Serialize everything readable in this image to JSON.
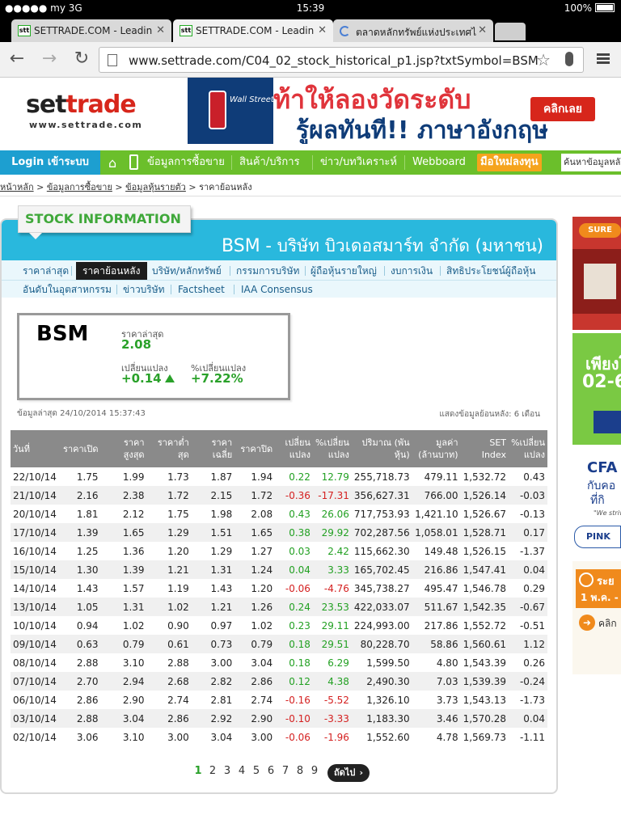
{
  "status_bar": {
    "carrier": "●●●●● my  3G",
    "time": "15:39",
    "battery": "100%"
  },
  "tabs": [
    {
      "title": "SETTRADE.COM - Leadin",
      "favicon": "stt"
    },
    {
      "title": "SETTRADE.COM - Leadin",
      "favicon": "stt"
    },
    {
      "title": "ตลาดหลักทรัพย์แห่งประเทศไ",
      "favicon": "loading"
    }
  ],
  "toolbar": {
    "url": "www.settrade.com/C04_02_stock_historical_p1.jsp?txtSymbol=BSM"
  },
  "header": {
    "logo_main": "set",
    "logo_accent": "trade",
    "logo_sub": "www.settrade.com",
    "banner_brand": "Wall Street English",
    "banner_line1": "ท้าให้ลองวัดระดับ",
    "banner_line2": "รู้ผลทันที!! ภาษาอังกฤษ",
    "banner_button": "คลิกเลย"
  },
  "nav": {
    "login": "Login เข้าระบบ",
    "items": [
      "ข้อมูลการซื้อขาย",
      "สินค้า/บริการ",
      "ข่าว/บทวิเคราะห์",
      "Webboard"
    ],
    "invest": "มือใหม่ลงทุน",
    "search_placeholder": "ค้นหาข้อมูลหลัก"
  },
  "breadcrumb": {
    "home": "หน้าหลัก",
    "trading": "ข้อมูลการซื้อขาย",
    "stock": "ข้อมูลหุ้นรายตัว",
    "current": "ราคาย้อนหลัง"
  },
  "stock_info": {
    "badge": "STOCK INFORMATION",
    "symbol": "BSM",
    "company": "บริษัท บิวเดอสมาร์ท จำกัด (มหาชน)",
    "subnav_row1": [
      "ราคาล่าสุด",
      "ราคาย้อนหลัง",
      "บริษัท/หลักทรัพย์",
      "กรรมการบริษัท",
      "ผู้ถือหุ้นรายใหญ่",
      "งบการเงิน",
      "สิทธิประโยชน์ผู้ถือหุ้น"
    ],
    "subnav_row2": [
      "อันดับในอุตสาหกรรม",
      "ข่าวบริษัท",
      "Factsheet",
      "IAA Consensus"
    ]
  },
  "summary": {
    "symbol": "BSM",
    "last_price_label": "ราคาล่าสุด",
    "last_price": "2.08",
    "change_label": "เปลี่ยนแปลง",
    "change": "+0.14",
    "pct_change_label": "%เปลี่ยนแปลง",
    "pct_change": "+7.22%",
    "last_update": "ข้อมูลล่าสุด 24/10/2014 15:37:43",
    "history_range": "แสดงข้อมูลย้อนหลัง: 6 เดือน"
  },
  "table": {
    "headers": [
      "วันที่",
      "ราคาเปิด",
      "ราคาสูงสุด",
      "ราคาต่ำสุด",
      "ราคาเฉลี่ย",
      "ราคาปิด",
      "เปลี่ยน แปลง",
      "%เปลี่ยน แปลง",
      "ปริมาณ (พันหุ้น)",
      "มูลค่า (ล้านบาท)",
      "SET Index",
      "%เปลี่ยน แปลง"
    ],
    "rows": [
      [
        "22/10/14",
        "1.75",
        "1.99",
        "1.73",
        "1.87",
        "1.94",
        "0.22",
        "12.79",
        "255,718.73",
        "479.11",
        "1,532.72",
        "0.43"
      ],
      [
        "21/10/14",
        "2.16",
        "2.38",
        "1.72",
        "2.15",
        "1.72",
        "-0.36",
        "-17.31",
        "356,627.31",
        "766.00",
        "1,526.14",
        "-0.03"
      ],
      [
        "20/10/14",
        "1.81",
        "2.12",
        "1.75",
        "1.98",
        "2.08",
        "0.43",
        "26.06",
        "717,753.93",
        "1,421.10",
        "1,526.67",
        "-0.13"
      ],
      [
        "17/10/14",
        "1.39",
        "1.65",
        "1.29",
        "1.51",
        "1.65",
        "0.38",
        "29.92",
        "702,287.56",
        "1,058.01",
        "1,528.71",
        "0.17"
      ],
      [
        "16/10/14",
        "1.25",
        "1.36",
        "1.20",
        "1.29",
        "1.27",
        "0.03",
        "2.42",
        "115,662.30",
        "149.48",
        "1,526.15",
        "-1.37"
      ],
      [
        "15/10/14",
        "1.30",
        "1.39",
        "1.21",
        "1.31",
        "1.24",
        "0.04",
        "3.33",
        "165,702.45",
        "216.86",
        "1,547.41",
        "0.04"
      ],
      [
        "14/10/14",
        "1.43",
        "1.57",
        "1.19",
        "1.43",
        "1.20",
        "-0.06",
        "-4.76",
        "345,738.27",
        "495.47",
        "1,546.78",
        "0.29"
      ],
      [
        "13/10/14",
        "1.05",
        "1.31",
        "1.02",
        "1.21",
        "1.26",
        "0.24",
        "23.53",
        "422,033.07",
        "511.67",
        "1,542.35",
        "-0.67"
      ],
      [
        "10/10/14",
        "0.94",
        "1.02",
        "0.90",
        "0.97",
        "1.02",
        "0.23",
        "29.11",
        "224,993.00",
        "217.86",
        "1,552.72",
        "-0.51"
      ],
      [
        "09/10/14",
        "0.63",
        "0.79",
        "0.61",
        "0.73",
        "0.79",
        "0.18",
        "29.51",
        "80,228.70",
        "58.86",
        "1,560.61",
        "1.12"
      ],
      [
        "08/10/14",
        "2.88",
        "3.10",
        "2.88",
        "3.00",
        "3.04",
        "0.18",
        "6.29",
        "1,599.50",
        "4.80",
        "1,543.39",
        "0.26"
      ],
      [
        "07/10/14",
        "2.70",
        "2.94",
        "2.68",
        "2.82",
        "2.86",
        "0.12",
        "4.38",
        "2,490.30",
        "7.03",
        "1,539.39",
        "-0.24"
      ],
      [
        "06/10/14",
        "2.86",
        "2.90",
        "2.74",
        "2.81",
        "2.74",
        "-0.16",
        "-5.52",
        "1,326.10",
        "3.73",
        "1,543.13",
        "-1.73"
      ],
      [
        "03/10/14",
        "2.88",
        "3.04",
        "2.86",
        "2.92",
        "2.90",
        "-0.10",
        "-3.33",
        "1,183.30",
        "3.46",
        "1,570.28",
        "0.04"
      ],
      [
        "02/10/14",
        "3.06",
        "3.10",
        "3.00",
        "3.04",
        "3.00",
        "-0.06",
        "-1.96",
        "1,552.60",
        "4.78",
        "1,569.73",
        "-1.11"
      ]
    ]
  },
  "pagination": {
    "pages": [
      "1",
      "2",
      "3",
      "4",
      "5",
      "6",
      "7",
      "8",
      "9"
    ],
    "current": "1",
    "next": "ถัดไป"
  },
  "ads": {
    "ad1_label": "SURE",
    "ad2_line1": "เพียงโ",
    "ad2_line2": "02-6",
    "ad3_brand": "CFA",
    "ad3_line1": "กับคอ",
    "ad3_line2": "ที่กิ",
    "ad3_tagline": "\"We strive",
    "ad3_pink": "PINK",
    "ad4_line1": "ระย",
    "ad4_line2": "1 พ.ค. -",
    "ad4_click": "คลิก"
  }
}
